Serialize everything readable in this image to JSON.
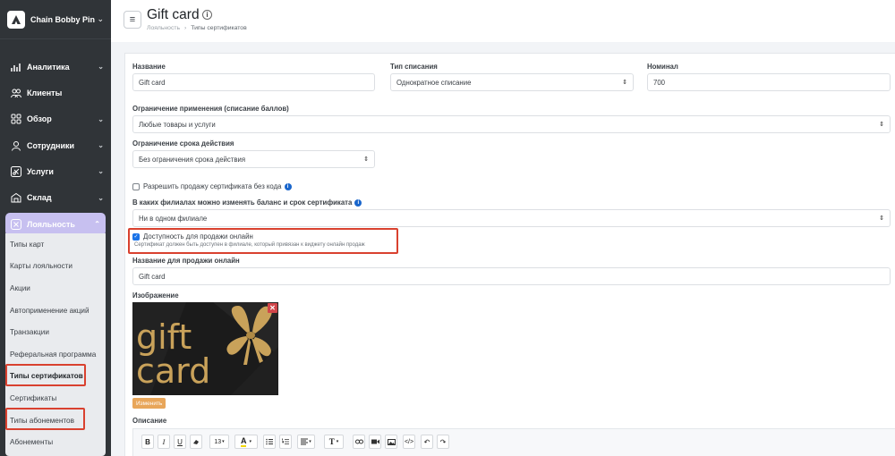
{
  "brand": {
    "name": "Chain Bobby Pin"
  },
  "sidebar": {
    "items": [
      {
        "label": "Аналитика",
        "icon": "chart-icon"
      },
      {
        "label": "Клиенты",
        "icon": "users-icon"
      },
      {
        "label": "Обзор",
        "icon": "grid-icon"
      },
      {
        "label": "Сотрудники",
        "icon": "user-icon"
      },
      {
        "label": "Услуги",
        "icon": "scissors-icon"
      },
      {
        "label": "Склад",
        "icon": "warehouse-icon"
      },
      {
        "label": "Лояльность",
        "icon": "loyalty-icon"
      }
    ],
    "sub_items": [
      {
        "label": "Типы карт"
      },
      {
        "label": "Карты лояльности"
      },
      {
        "label": "Акции"
      },
      {
        "label": "Автоприменение акций"
      },
      {
        "label": "Транзакции"
      },
      {
        "label": "Реферальная программа"
      },
      {
        "label": "Типы сертификатов"
      },
      {
        "label": "Сертификаты"
      },
      {
        "label": "Типы абонементов"
      },
      {
        "label": "Абонементы"
      }
    ]
  },
  "header": {
    "title": "Gift card",
    "info": "i",
    "breadcrumb": [
      "Лояльность",
      "Типы сертификатов"
    ]
  },
  "form": {
    "name_label": "Название",
    "name_value": "Gift card",
    "writeoff_label": "Тип списания",
    "writeoff_value": "Однократное списание",
    "nominal_label": "Номинал",
    "nominal_value": "700",
    "restriction_label": "Ограничение применения (списание баллов)",
    "restriction_value": "Любые товары и услуги",
    "term_label": "Ограничение срока действия",
    "term_value": "Без ограничения срока действия",
    "allow_sale_label": "Разрешить продажу сертификата без кода",
    "branches_label": "В каких филиалах можно изменять баланс и срок сертификата",
    "branches_value": "Ни в одном филиале",
    "online_label": "Доступность для продажи онлайн",
    "online_hint": "Сертификат должен быть доступен в филиале, который привязан к виджету онлайн продаж",
    "online_checked": true,
    "online_name_label": "Название для продажи онлайн",
    "online_name_value": "Gift card",
    "image_label": "Изображение",
    "image_text_1": "gift",
    "image_text_2": "card",
    "edit_button": "Изменить",
    "description_label": "Описание"
  },
  "toolbar": {
    "font_size": "13",
    "buttons": [
      "B",
      "I",
      "U",
      "eraser-icon",
      "font-size-select",
      "text-color-icon",
      "bullet-list-icon",
      "numbered-list-icon",
      "align-icon",
      "text-style-icon",
      "link-icon",
      "video-icon",
      "image-icon",
      "code-view-icon",
      "undo-icon",
      "redo-icon"
    ]
  },
  "colors": {
    "sidebar_bg": "#303438",
    "active_item": "#c7c0f0",
    "highlight_red": "#d9412f",
    "checkbox_blue": "#1a73e8",
    "edit_button": "#e8a65a"
  }
}
